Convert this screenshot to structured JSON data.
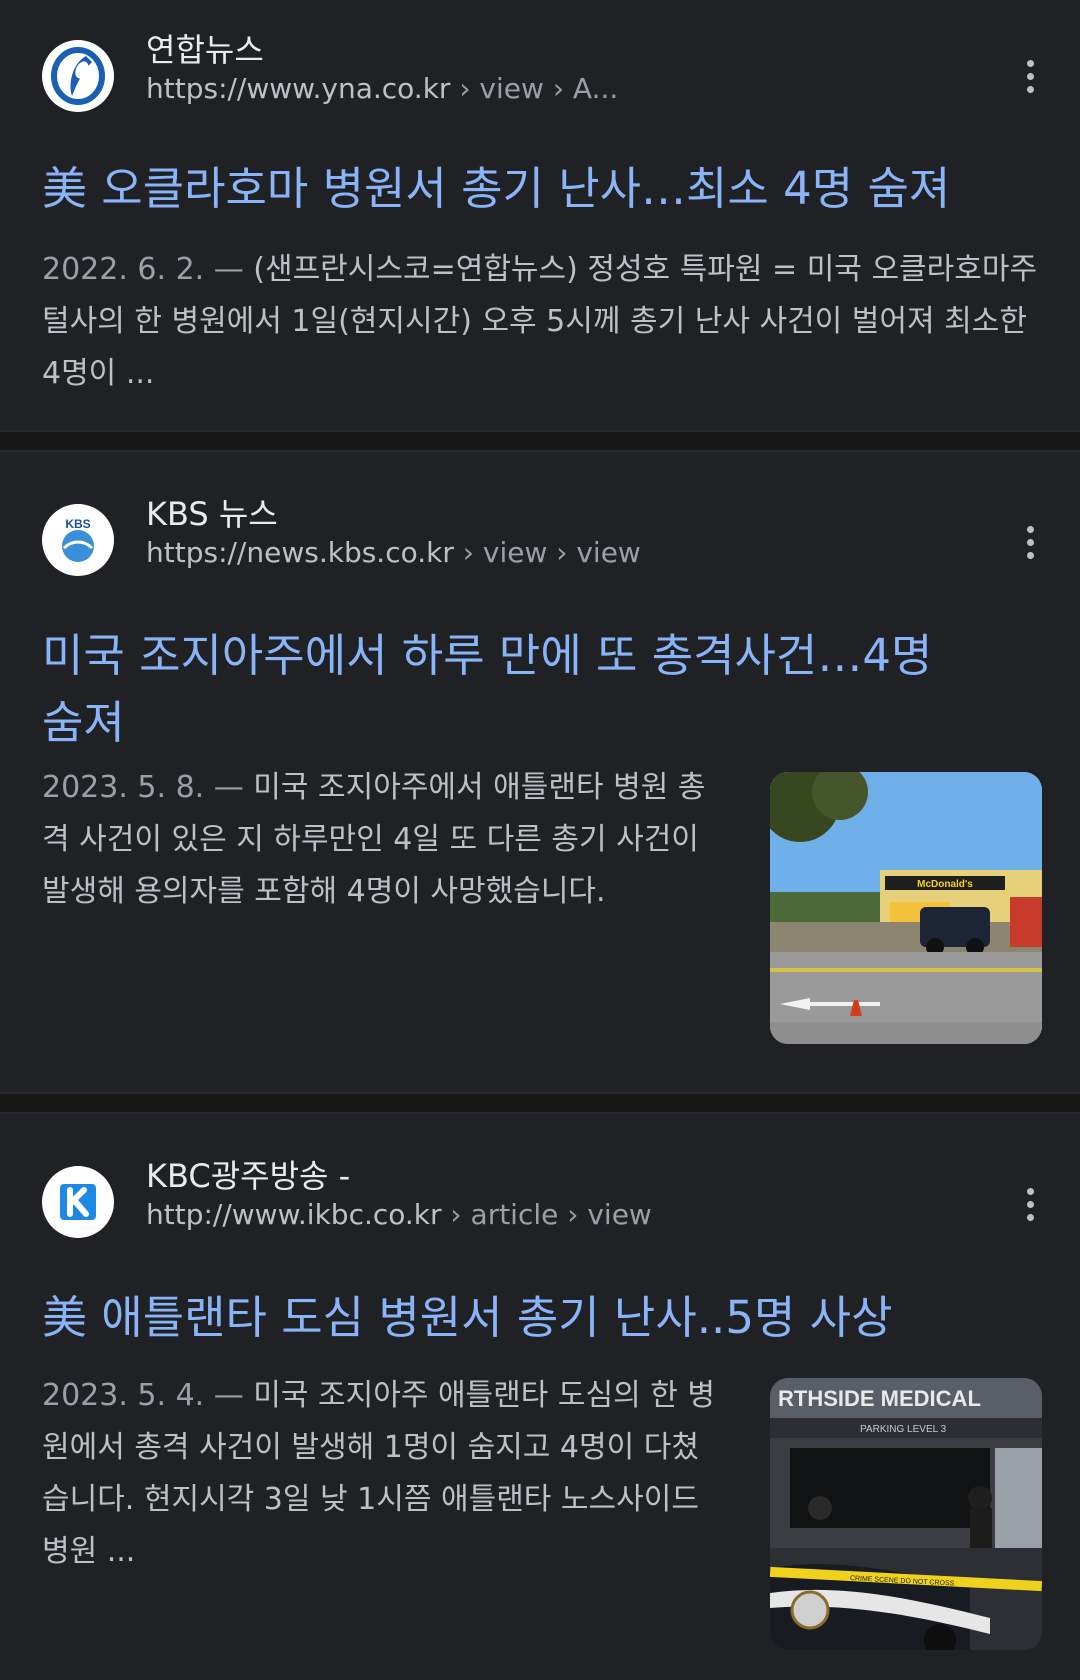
{
  "results": [
    {
      "site_name": "연합뉴스",
      "url_base": "https://www.yna.co.kr",
      "url_path": " › view › A...",
      "title": "美 오클라호마 병원서 총기 난사…최소 4명 숨져",
      "date": "2022. 6. 2. — ",
      "snippet": "(샌프란시스코=연합뉴스) 정성호 특파원 = 미국 오클라호마주 털사의 한 병원에서 1일(현지시간) 오후 5시께 총기 난사 사건이 벌어져 최소한 4명이 ...",
      "favicon_icon": "yonhap-logo-icon"
    },
    {
      "site_name": "KBS 뉴스",
      "url_base": "https://news.kbs.co.kr",
      "url_path": " › view › view",
      "title": "미국 조지아주에서 하루 만에 또 총격사건…4명 숨져",
      "date": "2023. 5. 8. — ",
      "snippet": "미국 조지아주에서 애틀랜타 병원 총격 사건이 있은 지 하루만인 4일 또 다른 총기 사건이 발생해 용의자를 포함해 4명이 사망했습니다.",
      "favicon_icon": "kbs-logo-icon",
      "favicon_text": "KBS",
      "thumb_sign": "McDonald's"
    },
    {
      "site_name": "KBC광주방송 -",
      "url_base": "http://www.ikbc.co.kr",
      "url_path": " › article › view",
      "title": "美 애틀랜타 도심 병원서 총기 난사..5명 사상",
      "date": "2023. 5. 4. — ",
      "snippet": "미국 조지아주 애틀랜타 도심의 한 병원에서 총격 사건이 발생해 1명이 숨지고 4명이 다쳤습니다. 현지시각 3일 낮 1시쯤 애틀랜타 노스사이드 병원 ...",
      "favicon_icon": "kbc-logo-icon",
      "thumb_sign": "RTHSIDE MEDICAL",
      "thumb_sub": "PARKING LEVEL 3",
      "thumb_tape": "CRIME SCENE DO NOT CROSS"
    }
  ],
  "colors": {
    "background": "#202124",
    "title_link": "#8ab4f8",
    "snippet_text": "#bdc1c6"
  }
}
